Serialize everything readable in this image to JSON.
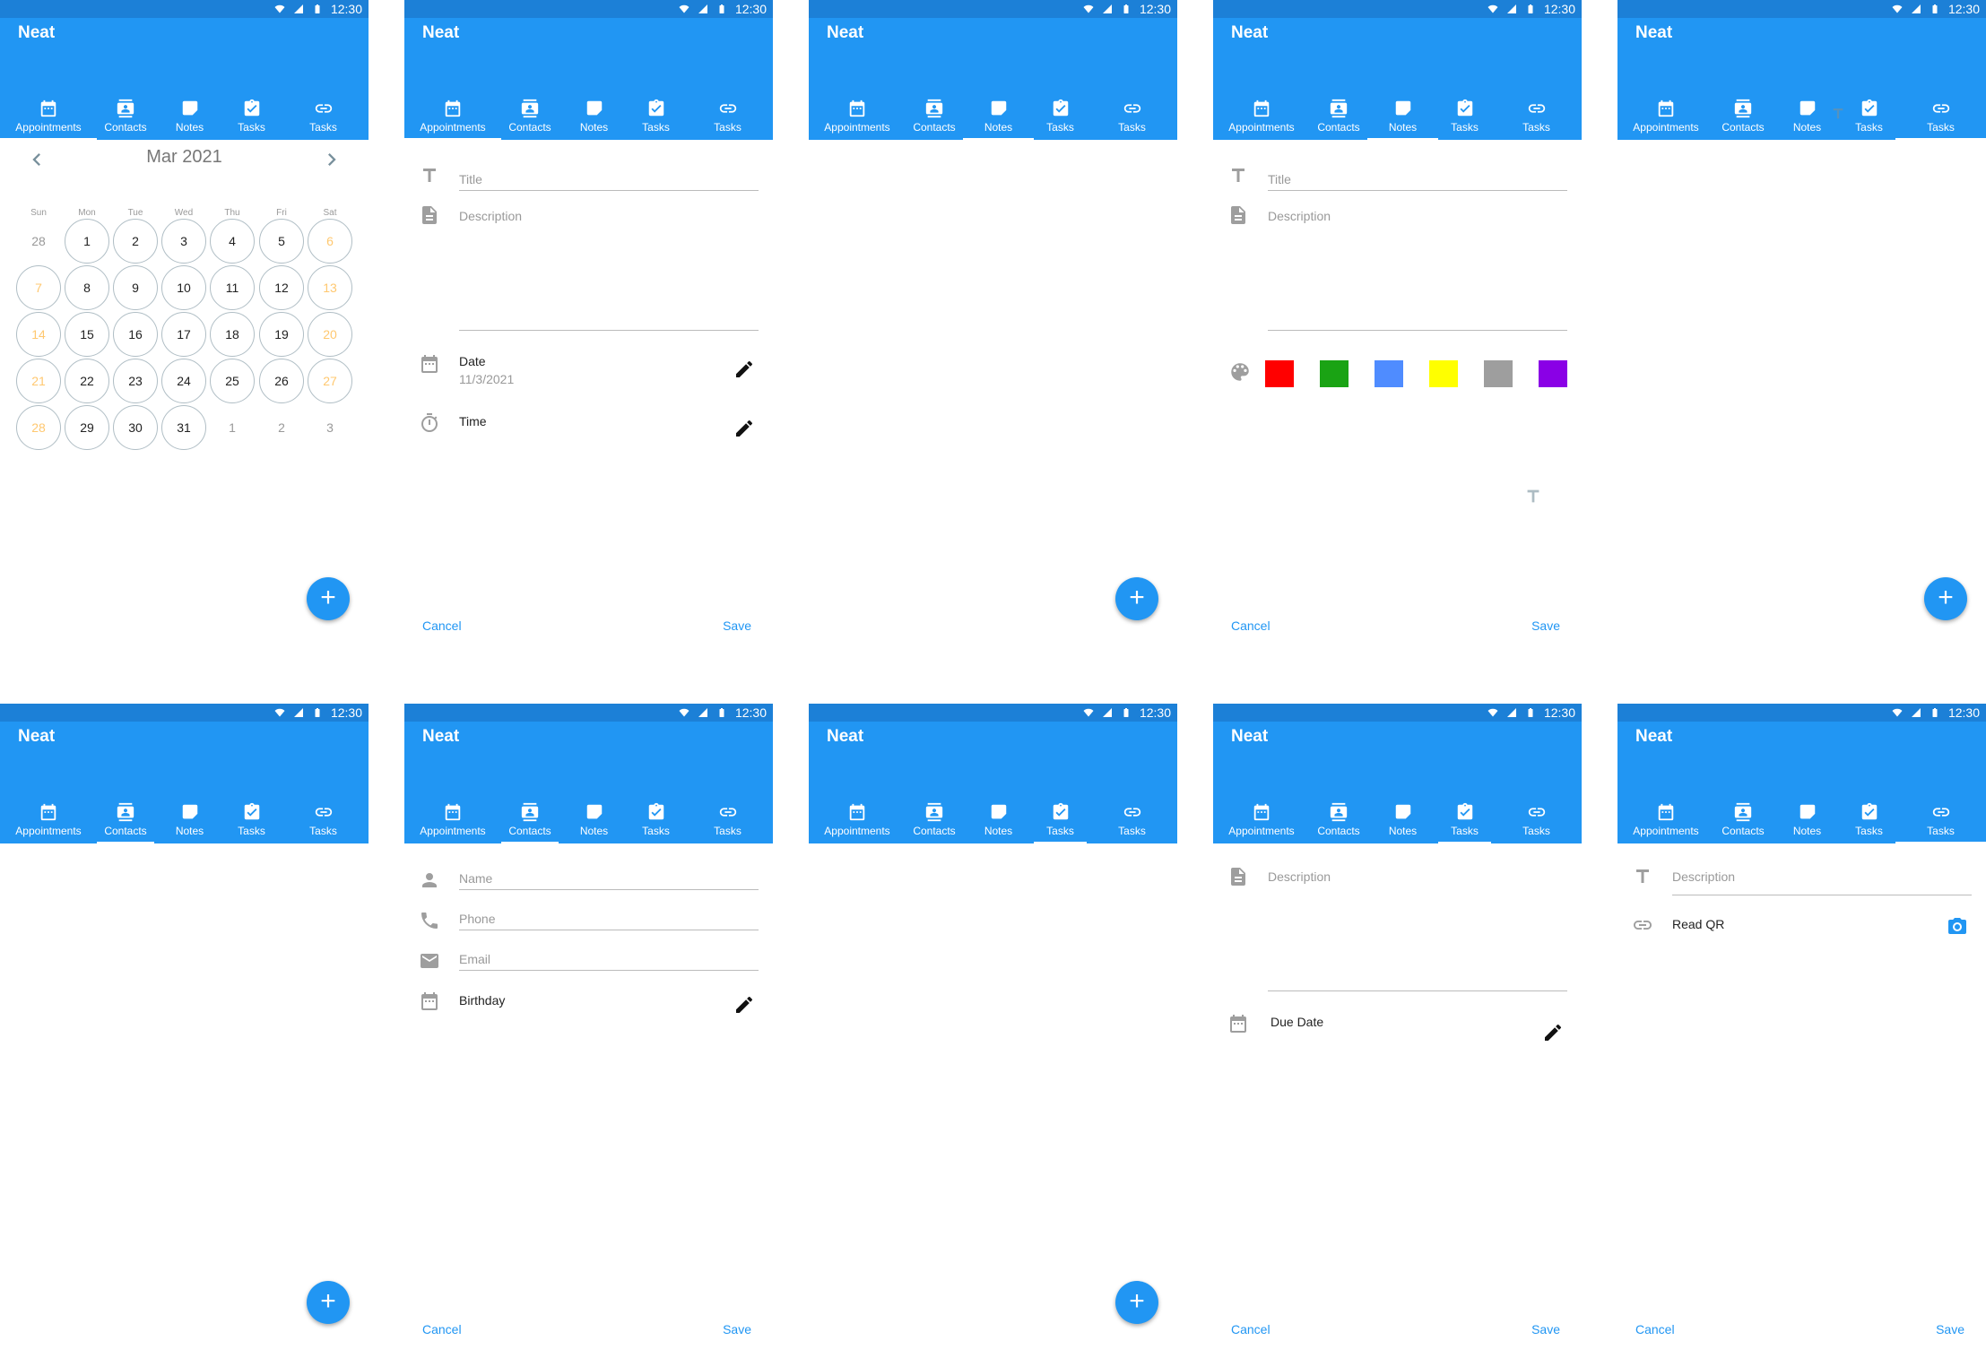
{
  "status_time": "12:30",
  "app_title": "Neat",
  "tabs": [
    {
      "label": "Appointments",
      "icon": "calendar-icon"
    },
    {
      "label": "Contacts",
      "icon": "contact-card-icon"
    },
    {
      "label": "Notes",
      "icon": "note-icon"
    },
    {
      "label": "Tasks",
      "icon": "task-check-icon"
    },
    {
      "label": "Tasks",
      "icon": "link-icon"
    }
  ],
  "colors": {
    "primary": "#2196f3",
    "status_bar": "#1c80d7",
    "weekend": "#ffc870"
  },
  "calendar": {
    "month_label": "Mar 2021",
    "weekdays": [
      "Sun",
      "Mon",
      "Tue",
      "Wed",
      "Thu",
      "Fri",
      "Sat"
    ],
    "days": [
      {
        "label": "28",
        "kind": "out"
      },
      {
        "label": "1",
        "kind": "in"
      },
      {
        "label": "2",
        "kind": "in"
      },
      {
        "label": "3",
        "kind": "in"
      },
      {
        "label": "4",
        "kind": "in"
      },
      {
        "label": "5",
        "kind": "in"
      },
      {
        "label": "6",
        "kind": "weekend"
      },
      {
        "label": "7",
        "kind": "weekend"
      },
      {
        "label": "8",
        "kind": "in"
      },
      {
        "label": "9",
        "kind": "in"
      },
      {
        "label": "10",
        "kind": "in"
      },
      {
        "label": "11",
        "kind": "in"
      },
      {
        "label": "12",
        "kind": "in"
      },
      {
        "label": "13",
        "kind": "weekend"
      },
      {
        "label": "14",
        "kind": "weekend"
      },
      {
        "label": "15",
        "kind": "in"
      },
      {
        "label": "16",
        "kind": "in"
      },
      {
        "label": "17",
        "kind": "in"
      },
      {
        "label": "18",
        "kind": "in"
      },
      {
        "label": "19",
        "kind": "in"
      },
      {
        "label": "20",
        "kind": "weekend"
      },
      {
        "label": "21",
        "kind": "weekend"
      },
      {
        "label": "22",
        "kind": "in"
      },
      {
        "label": "23",
        "kind": "in"
      },
      {
        "label": "24",
        "kind": "in"
      },
      {
        "label": "25",
        "kind": "in"
      },
      {
        "label": "26",
        "kind": "in"
      },
      {
        "label": "27",
        "kind": "weekend"
      },
      {
        "label": "28",
        "kind": "weekend"
      },
      {
        "label": "29",
        "kind": "in"
      },
      {
        "label": "30",
        "kind": "in"
      },
      {
        "label": "31",
        "kind": "in"
      },
      {
        "label": "1",
        "kind": "out"
      },
      {
        "label": "2",
        "kind": "out"
      },
      {
        "label": "3",
        "kind": "out"
      }
    ]
  },
  "fab_label": "+",
  "actions": {
    "cancel": "Cancel",
    "save": "Save"
  },
  "appointment_form": {
    "title_placeholder": "Title",
    "description_placeholder": "Description",
    "date_label": "Date",
    "date_value": "11/3/2021",
    "time_label": "Time"
  },
  "note_form": {
    "title_placeholder": "Title",
    "description_placeholder": "Description",
    "palette": [
      "#ff0000",
      "#1aa314",
      "#4f8cff",
      "#ffff00",
      "#9e9e9e",
      "#8a00e6"
    ]
  },
  "contact_form": {
    "name_placeholder": "Name",
    "phone_placeholder": "Phone",
    "email_placeholder": "Email",
    "birthday_label": "Birthday"
  },
  "task_form": {
    "description_placeholder": "Description",
    "due_date_label": "Due Date"
  },
  "link_form": {
    "description_placeholder": "Description",
    "read_qr_label": "Read QR"
  }
}
